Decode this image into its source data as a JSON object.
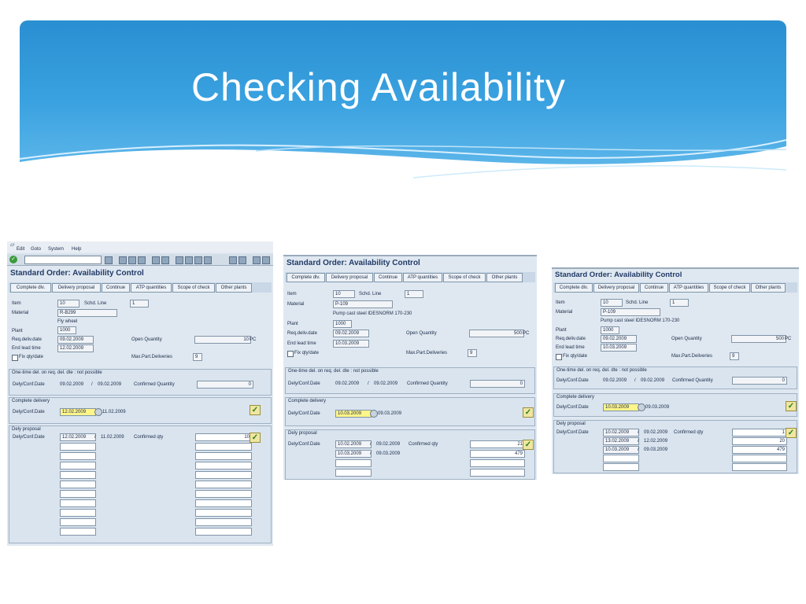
{
  "slide": {
    "title": "Checking Availability"
  },
  "screens": [
    {
      "menu": [
        "Edit",
        "Goto",
        "System",
        "Help"
      ],
      "title": "Standard Order: Availability Control",
      "buttons": [
        "Complete dlv.",
        "Delivery proposal",
        "Continue",
        "ATP quantities",
        "Scope of check",
        "Other plants"
      ],
      "item_label": "Item",
      "item": "10",
      "schd_line_label": "Schd. Line",
      "schd_line": "1",
      "material_label": "Material",
      "material": "R-B299",
      "material_desc": "Fly wheel",
      "plant_label": "Plant",
      "plant": "1000",
      "req_deliv_label": "Req.deliv.date",
      "req_deliv": "09.02.2009",
      "end_lead_label": "End lead time",
      "end_lead": "12.02.2009",
      "open_qty_label": "Open Quantity",
      "open_qty": "10",
      "unit": "PC",
      "fix_label": "Fix qty/date",
      "max_part_label": "Max.Part.Deliveries",
      "max_part": "9",
      "one_time": {
        "title": "One-time del. on req. del. dte : not possible",
        "label": "Dely/Conf.Date",
        "date1": "09.02.2009",
        "date2": "09.02.2009",
        "conf_label": "Confirmed Quantity",
        "qty": "0"
      },
      "complete": {
        "title": "Complete delivery",
        "label": "Dely/Conf.Date",
        "date1": "12.02.2009",
        "date2": "11.02.2009"
      },
      "proposal": {
        "title": "Dely proposal",
        "label": "Dely/Conf.Date",
        "conf_label": "Confirmed qty",
        "rows": [
          {
            "d1": "12.02.2009",
            "d2": "11.02.2009",
            "qty": "10"
          }
        ]
      }
    },
    {
      "title": "Standard Order: Availability Control",
      "buttons": [
        "Complete dlv.",
        "Delivery proposal",
        "Continue",
        "ATP quantities",
        "Scope of check",
        "Other plants"
      ],
      "item_label": "Item",
      "item": "10",
      "schd_line_label": "Schd. Line",
      "schd_line": "1",
      "material_label": "Material",
      "material": "P-109",
      "material_desc": "Pump cast steel IDESNORM 170-230",
      "plant_label": "Plant",
      "plant": "1000",
      "req_deliv_label": "Req.deliv.date",
      "req_deliv": "09.02.2009",
      "end_lead_label": "End lead time",
      "end_lead": "10.03.2009",
      "open_qty_label": "Open Quantity",
      "open_qty": "500",
      "unit": "PC",
      "fix_label": "Fix qty/date",
      "max_part_label": "Max.Part.Deliveries",
      "max_part": "9",
      "one_time": {
        "title": "One-time del. on req. del. dte : not possible",
        "label": "Dely/Conf.Date",
        "date1": "09.02.2009",
        "date2": "09.02.2009",
        "conf_label": "Confirmed Quantity",
        "qty": "0"
      },
      "complete": {
        "title": "Complete delivery",
        "label": "Dely/Conf.Date",
        "date1": "10.03.2009",
        "date2": "09.03.2009"
      },
      "proposal": {
        "title": "Dely proposal",
        "label": "Dely/Conf.Date",
        "conf_label": "Confirmed qty",
        "rows": [
          {
            "d1": "10.02.2009",
            "d2": "09.02.2009",
            "qty": "21"
          },
          {
            "d1": "10.03.2009",
            "d2": "09.03.2009",
            "qty": "479"
          }
        ]
      }
    },
    {
      "title": "Standard Order: Availability Control",
      "buttons": [
        "Complete dlv.",
        "Delivery proposal",
        "Continue",
        "ATP quantities",
        "Scope of check",
        "Other plants"
      ],
      "item_label": "Item",
      "item": "10",
      "schd_line_label": "Schd. Line",
      "schd_line": "1",
      "material_label": "Material",
      "material": "P-109",
      "material_desc": "Pump cast steel IDESNORM 170-230",
      "plant_label": "Plant",
      "plant": "1000",
      "req_deliv_label": "Req.deliv.date",
      "req_deliv": "09.02.2009",
      "end_lead_label": "End lead time",
      "end_lead": "10.03.2009",
      "open_qty_label": "Open Quantity",
      "open_qty": "500",
      "unit": "PC",
      "fix_label": "Fix qty/date",
      "max_part_label": "Max.Part.Deliveries",
      "max_part": "9",
      "one_time": {
        "title": "One-time del. on req. del. dte : not possible",
        "label": "Dely/Conf.Date",
        "date1": "09.02.2009",
        "date2": "09.02.2009",
        "conf_label": "Confirmed Quantity",
        "qty": "0"
      },
      "complete": {
        "title": "Complete delivery",
        "label": "Dely/Conf.Date",
        "date1": "10.03.2009",
        "date2": "09.03.2009"
      },
      "proposal": {
        "title": "Dely proposal",
        "label": "Dely/Conf.Date",
        "conf_label": "Confirmed qty",
        "rows": [
          {
            "d1": "10.02.2009",
            "d2": "09.02.2009",
            "qty": "1"
          },
          {
            "d1": "13.02.2009",
            "d2": "12.02.2009",
            "qty": "20"
          },
          {
            "d1": "10.03.2009",
            "d2": "09.03.2009",
            "qty": "479"
          }
        ]
      }
    }
  ]
}
